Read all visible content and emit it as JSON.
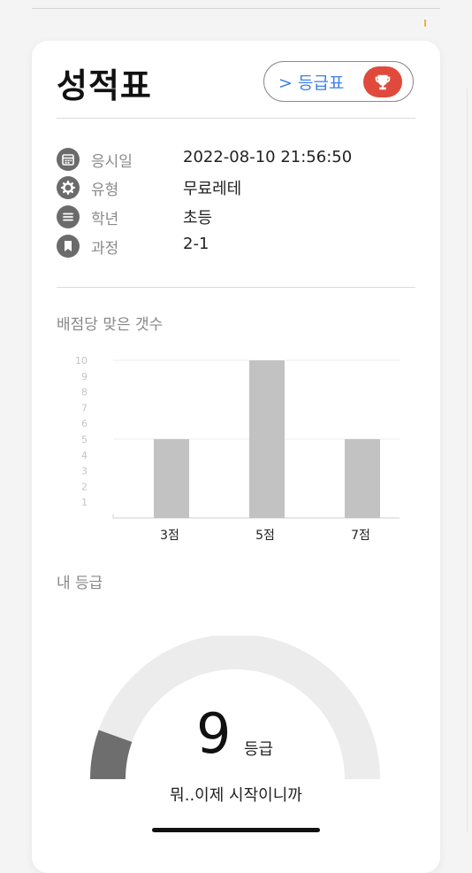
{
  "header": {
    "title": "성적표",
    "grade_table_button": "> 등급표"
  },
  "info": [
    {
      "icon": "calendar-icon",
      "label": "응시일",
      "value": "2022-08-10 21:56:50"
    },
    {
      "icon": "gear-icon",
      "label": "유형",
      "value": "무료레테"
    },
    {
      "icon": "list-icon",
      "label": "학년",
      "value": "초등"
    },
    {
      "icon": "bookmark-icon",
      "label": "과정",
      "value": "2-1"
    }
  ],
  "chart_section": {
    "label": "배점당 맞은 갯수"
  },
  "chart_data": {
    "type": "bar",
    "categories": [
      "3점",
      "5점",
      "7점"
    ],
    "values": [
      5,
      10,
      5
    ],
    "ylim": [
      0,
      10
    ],
    "yticks": [
      1,
      2,
      3,
      4,
      5,
      6,
      7,
      8,
      9,
      10
    ],
    "bar_color": "#c2c2c2"
  },
  "grade_section": {
    "label": "내 등급",
    "grade": "9",
    "grade_unit": "등급",
    "message": "뭐..이제 시작이니까",
    "gauge_fill": 0.11
  },
  "colors": {
    "accent": "#3f7fe6",
    "trophy": "#e04a3c",
    "icon": "#6b6b6b"
  }
}
